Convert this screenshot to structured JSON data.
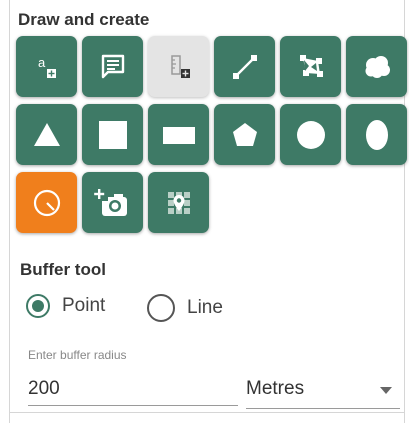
{
  "draw_section": {
    "title": "Draw and create"
  },
  "tools": [
    {
      "name": "text-annotation",
      "icon": "text-add-icon",
      "state": "normal"
    },
    {
      "name": "comment",
      "icon": "comment-icon",
      "state": "normal"
    },
    {
      "name": "measure-label",
      "icon": "ruler-add-icon",
      "state": "disabled"
    },
    {
      "name": "line",
      "icon": "line-icon",
      "state": "normal"
    },
    {
      "name": "polygon-freeform",
      "icon": "polygon-vertices-icon",
      "state": "normal"
    },
    {
      "name": "cloud",
      "icon": "cloud-icon",
      "state": "normal"
    },
    {
      "name": "triangle",
      "icon": "triangle-icon",
      "state": "normal"
    },
    {
      "name": "square",
      "icon": "square-icon",
      "state": "normal"
    },
    {
      "name": "rectangle",
      "icon": "rectangle-icon",
      "state": "normal"
    },
    {
      "name": "pentagon",
      "icon": "pentagon-icon",
      "state": "normal"
    },
    {
      "name": "circle",
      "icon": "circle-icon",
      "state": "normal"
    },
    {
      "name": "ellipse",
      "icon": "ellipse-icon",
      "state": "normal"
    },
    {
      "name": "buffer",
      "icon": "buffer-circle-icon",
      "state": "active"
    },
    {
      "name": "add-photo",
      "icon": "add-photo-icon",
      "state": "normal"
    },
    {
      "name": "grid-marker",
      "icon": "grid-marker-icon",
      "state": "normal"
    }
  ],
  "buffer_section": {
    "title": "Buffer tool",
    "options": [
      {
        "label": "Point",
        "checked": true
      },
      {
        "label": "Line",
        "checked": false
      }
    ],
    "radius_label": "Enter buffer radius",
    "radius_value": "200",
    "unit_selected": "Metres"
  },
  "colors": {
    "tool_green": "#3e7a66",
    "tool_active_orange": "#f07f1c",
    "tool_disabled": "#e4e4e4"
  }
}
